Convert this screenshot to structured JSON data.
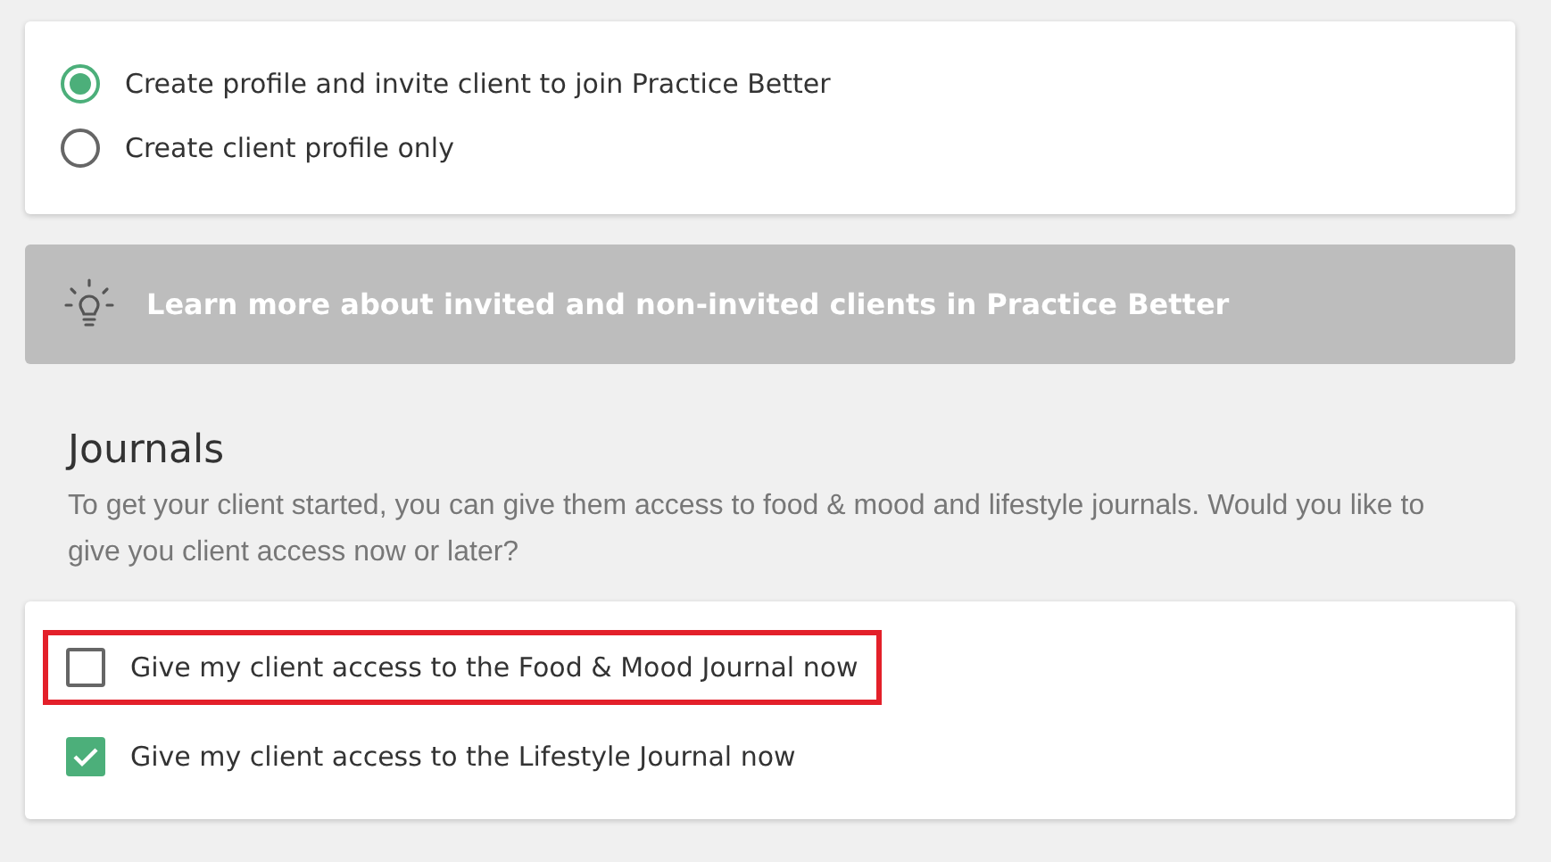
{
  "invite_options": [
    {
      "label": "Create profile and invite client to join Practice Better",
      "selected": true
    },
    {
      "label": "Create client profile only",
      "selected": false
    }
  ],
  "info_banner": {
    "text": "Learn more about invited and non-invited clients in Practice Better"
  },
  "journals": {
    "title": "Journals",
    "description": "To get your client started, you can give them access to food & mood and lifestyle journals. Would you like to give you client access now or later?",
    "options": [
      {
        "label": "Give my client access to the Food & Mood Journal now",
        "checked": false,
        "highlighted": true
      },
      {
        "label": "Give my client access to the Lifestyle Journal now",
        "checked": true,
        "highlighted": false
      }
    ]
  }
}
